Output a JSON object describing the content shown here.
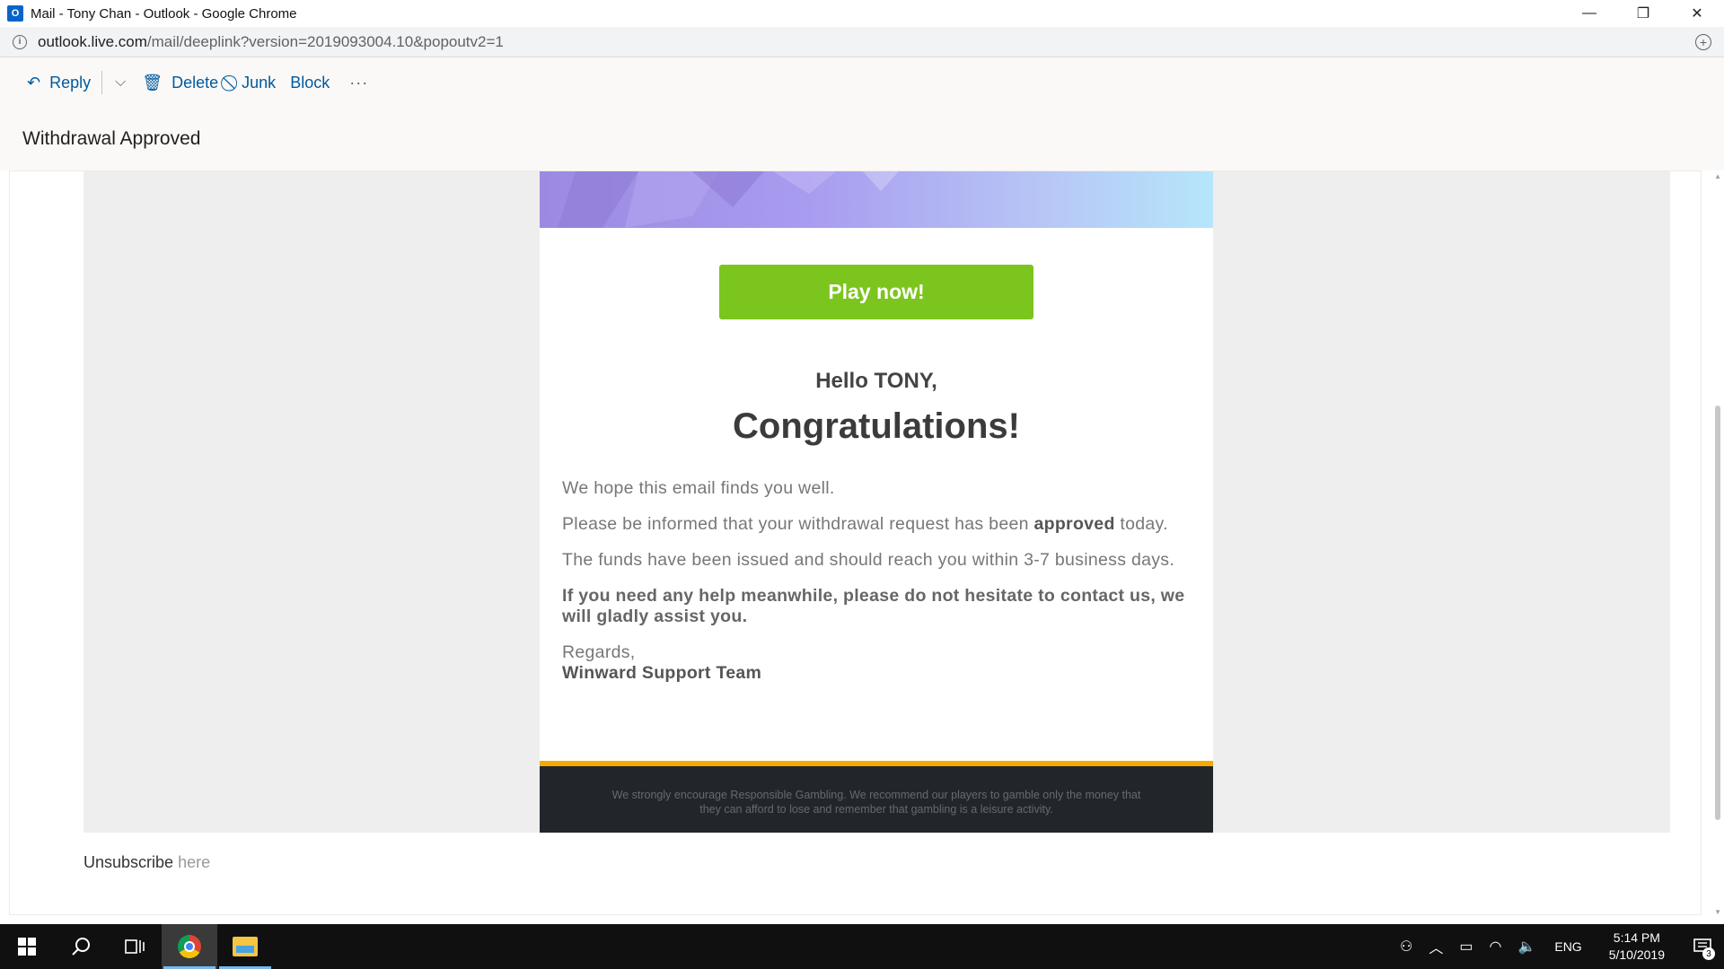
{
  "window": {
    "title": "Mail - Tony Chan - Outlook - Google Chrome",
    "app_icon_letter": "O",
    "minimize": "—",
    "restore": "❐",
    "close": "✕"
  },
  "address": {
    "domain": "outlook.live.com",
    "path": "/mail/deeplink?version=2019093004.10&popoutv2=1"
  },
  "toolbar": {
    "reply_label": "Reply",
    "delete_label": "Delete",
    "junk_label": "Junk",
    "block_label": "Block",
    "more_label": "···",
    "chevron": "⌵"
  },
  "message": {
    "subject": "Withdrawal Approved",
    "cta_label": "Play now!",
    "greeting": "Hello TONY,",
    "headline": "Congratulations!",
    "para1": "We hope this email finds you well.",
    "para2_start": "Please be informed that your withdrawal request has been ",
    "para2_bold": "approved",
    "para2_end": " today.",
    "para3": "The funds have been issued and should reach you within 3-7 business days.",
    "para4": "If you need any help meanwhile, please do not hesitate to contact us, we will gladly assist you.",
    "regards": "Regards,",
    "signature": "Winward Support Team",
    "disclaimer": "We strongly encourage Responsible Gambling. We recommend our players to gamble only the money that they can afford to lose and remember that gambling is a leisure activity.",
    "unsubscribe_text": "Unsubscribe",
    "unsubscribe_link": "here"
  },
  "taskbar": {
    "lang": "ENG",
    "time": "5:14 PM",
    "date": "5/10/2019",
    "notification_count": "3"
  },
  "colors": {
    "cta": "#7cc51e",
    "footer_accent": "#f5a800",
    "footer_bg": "#22262b",
    "outlook_blue": "#005a9e"
  }
}
